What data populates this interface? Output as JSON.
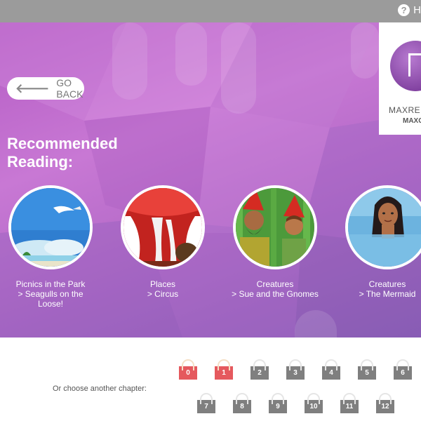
{
  "topbar": {
    "help_label": "H",
    "help_icon": "question-circle-icon"
  },
  "logo": {
    "text": "MAXRE",
    "sub": "MAXG"
  },
  "go_back": {
    "label": "GO BACK",
    "icon": "arrow-left-icon"
  },
  "recommended": {
    "title_line1": "Recommended",
    "title_line2": "Reading:",
    "books": [
      {
        "line1": "Picnics in the Park",
        "line2": "> Seagulls on the",
        "line3": "Loose!"
      },
      {
        "line1": "Places",
        "line2": "> Circus",
        "line3": ""
      },
      {
        "line1": "Creatures",
        "line2": "> Sue and the Gnomes",
        "line3": ""
      },
      {
        "line1": "Creatures",
        "line2": "> The Mermaid",
        "line3": ""
      }
    ]
  },
  "chapters": {
    "label": "Or choose another chapter:",
    "items": [
      "0",
      "1",
      "2",
      "3",
      "4",
      "5",
      "6",
      "7",
      "8",
      "9",
      "10",
      "11",
      "12"
    ],
    "unlocked": [
      "0",
      "1"
    ],
    "colors": {
      "unlocked": "#e5595e",
      "locked": "#7f7f7f"
    }
  }
}
